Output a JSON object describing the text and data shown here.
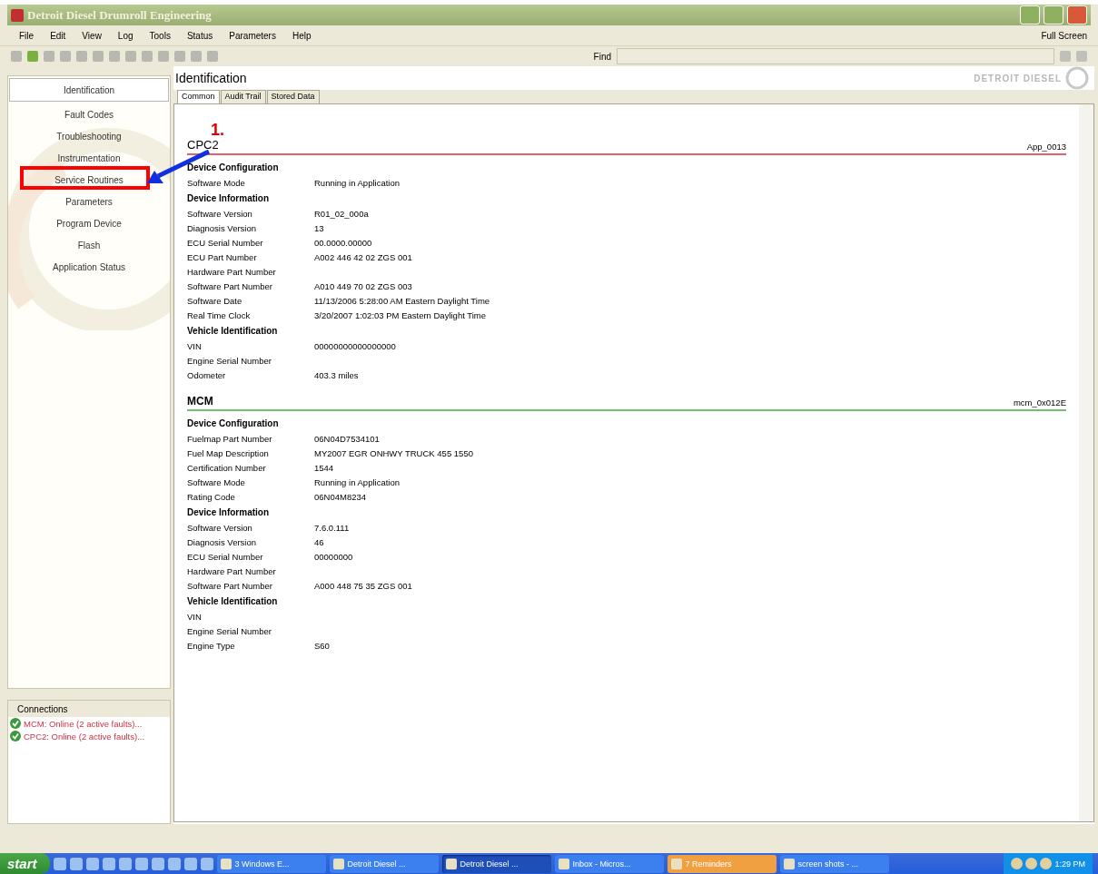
{
  "window": {
    "title": "Detroit Diesel Drumroll Engineering"
  },
  "menu": [
    "File",
    "Edit",
    "View",
    "Log",
    "Tools",
    "Status",
    "Parameters",
    "Help"
  ],
  "full_screen": "Full Screen",
  "find": {
    "label": "Find"
  },
  "logo": {
    "text": "DETROIT DIESEL"
  },
  "sidebar": {
    "items": [
      {
        "label": "Identification",
        "selected": true
      },
      {
        "label": "Fault Codes",
        "selected": false
      },
      {
        "label": "Troubleshooting",
        "selected": false
      },
      {
        "label": "Instrumentation",
        "selected": false
      },
      {
        "label": "Service Routines",
        "selected": false
      },
      {
        "label": "Parameters",
        "selected": false
      },
      {
        "label": "Program Device",
        "selected": false
      },
      {
        "label": "Flash",
        "selected": false
      },
      {
        "label": "Application Status",
        "selected": false
      }
    ]
  },
  "connections": {
    "title": "Connections",
    "items": [
      {
        "text": "MCM: Online (2 active faults)..."
      },
      {
        "text": "CPC2: Online (2 active faults)..."
      }
    ]
  },
  "page_title": "Identification",
  "tabs": [
    {
      "label": "Common",
      "selected": true
    },
    {
      "label": "Audit Trail",
      "selected": false
    },
    {
      "label": "Stored Data",
      "selected": false
    }
  ],
  "devices": [
    {
      "name": "CPC2",
      "code": "App_0013",
      "color": "#e06070",
      "groups": [
        {
          "title": "Device Configuration",
          "rows": [
            {
              "label": "Software Mode",
              "value": "Running in Application"
            }
          ]
        },
        {
          "title": "Device Information",
          "rows": [
            {
              "label": "Software Version",
              "value": "R01_02_000a"
            },
            {
              "label": "Diagnosis Version",
              "value": "13"
            },
            {
              "label": "ECU Serial Number",
              "value": "00.0000.00000"
            },
            {
              "label": "ECU Part Number",
              "value": "A002 446 42 02 ZGS 001"
            },
            {
              "label": "Hardware Part Number"
            },
            {
              "label": "Software Part Number",
              "value": "A010 449 70 02 ZGS 003"
            },
            {
              "label": "Software Date",
              "value": "11/13/2006 5:28:00 AM Eastern Daylight Time"
            },
            {
              "label": "Real Time Clock",
              "value": "3/20/2007 1:02:03 PM Eastern Daylight Time"
            }
          ]
        },
        {
          "title": "Vehicle Identification",
          "rows": [
            {
              "label": "VIN",
              "value": "00000000000000000"
            },
            {
              "label": "Engine Serial Number"
            },
            {
              "label": "Odometer",
              "value": "403.3 miles"
            }
          ]
        }
      ]
    },
    {
      "name": "MCM",
      "code": "mcm_0x012E",
      "color": "#70c070",
      "groups": [
        {
          "title": "Device Configuration",
          "rows": [
            {
              "label": "Fuelmap Part Number",
              "value": "06N04D7534101"
            },
            {
              "label": "Fuel Map Description",
              "value": "MY2007 EGR ONHWY TRUCK 455 1550"
            },
            {
              "label": "Certification Number",
              "value": "1544"
            },
            {
              "label": "Software Mode",
              "value": "Running in Application"
            },
            {
              "label": "Rating Code",
              "value": "06N04M8234"
            }
          ]
        },
        {
          "title": "Device Information",
          "rows": [
            {
              "label": "Software Version",
              "value": "7.6.0.111"
            },
            {
              "label": "Diagnosis Version",
              "value": "46"
            },
            {
              "label": "ECU Serial Number",
              "value": "00000000"
            },
            {
              "label": "Hardware Part Number"
            },
            {
              "label": "Software Part Number",
              "value": "A000 448 75 35 ZGS 001"
            }
          ]
        },
        {
          "title": "Vehicle Identification",
          "rows": [
            {
              "label": "VIN"
            },
            {
              "label": "Engine Serial Number"
            },
            {
              "label": "Engine Type",
              "value": "S60"
            }
          ]
        }
      ]
    }
  ],
  "annotation": {
    "number": "1."
  },
  "taskbar": {
    "start": "start",
    "buttons": [
      {
        "label": "3 Windows E...",
        "selected": false,
        "flashing": false
      },
      {
        "label": "Detroit Diesel ...",
        "selected": false,
        "flashing": false
      },
      {
        "label": "Detroit Diesel ...",
        "selected": true,
        "flashing": false
      },
      {
        "label": "Inbox - Micros...",
        "selected": false,
        "flashing": false
      },
      {
        "label": "7 Reminders",
        "selected": false,
        "flashing": true
      },
      {
        "label": "screen shots - ...",
        "selected": false,
        "flashing": false
      }
    ],
    "clock": "1:29 PM"
  }
}
